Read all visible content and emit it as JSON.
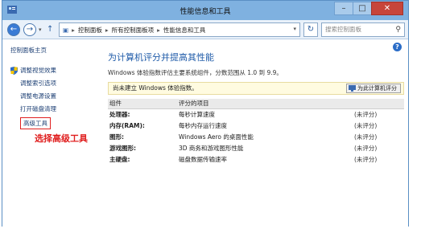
{
  "window": {
    "title": "性能信息和工具"
  },
  "address": {
    "segments": [
      "控制面板",
      "所有控制面板项",
      "性能信息和工具"
    ],
    "search_placeholder": "搜索控制面板"
  },
  "sidebar": {
    "home": "控制面板主页",
    "items": [
      "调整视觉效果",
      "调整索引选项",
      "调整电源设置",
      "打开磁盘清理",
      "高级工具"
    ]
  },
  "annotation": "选择高级工具",
  "main": {
    "heading": "为计算机评分并提高其性能",
    "description": "Windows 体验指数评估主要系统组件，分数范围从 1.0 到 9.9。",
    "notice": "尚未建立 Windows 体验指数。",
    "rate_button": "为此计算机评分",
    "table": {
      "headers": [
        "组件",
        "评分的项目",
        ""
      ],
      "rows": [
        {
          "component": "处理器:",
          "item": "每秒计算速度",
          "score": "(未评分)"
        },
        {
          "component": "内存(RAM):",
          "item": "每秒内存运行速度",
          "score": "(未评分)"
        },
        {
          "component": "图形:",
          "item": "Windows Aero 的桌面性能",
          "score": "(未评分)"
        },
        {
          "component": "游戏图形:",
          "item": "3D 商务和游戏图形性能",
          "score": "(未评分)"
        },
        {
          "component": "主硬盘:",
          "item": "磁盘数据传输速率",
          "score": "(未评分)"
        }
      ]
    }
  },
  "colors": {
    "accent": "#1e5aa8",
    "annotation": "#e02020",
    "frame": "#7fb1e0"
  }
}
